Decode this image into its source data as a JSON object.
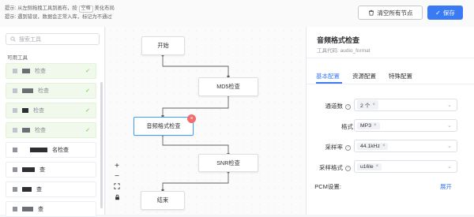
{
  "tips": {
    "line1_pre": "提示: 从左侧拖拽工具到画布，按",
    "line1_key": "空格",
    "line1_post": "美化布局",
    "line2": "提示: 遇到错误，数据会正常入库，标记为不通过"
  },
  "toolbar": {
    "clear_label": "清空所有节点",
    "save_label": "保存"
  },
  "left": {
    "search_placeholder": "搜索工具",
    "available_label": "可用工具",
    "tools": [
      {
        "label": "检查",
        "used": true
      },
      {
        "label": "检查",
        "used": true
      },
      {
        "label": "检查",
        "used": true
      },
      {
        "label": "检查",
        "used": true
      },
      {
        "label": "名检查",
        "used": false
      },
      {
        "label": "查",
        "used": false
      },
      {
        "label": "查",
        "used": false
      },
      {
        "label": "查",
        "used": false
      }
    ]
  },
  "canvas": {
    "nodes": [
      "开始",
      "MD5检查",
      "音频格式检查",
      "SNR检查",
      "结束"
    ],
    "zoom_in": "+",
    "zoom_out": "−"
  },
  "panel": {
    "title": "音频格式检查",
    "code": "工具代码: audio_format",
    "tabs": [
      "基本配置",
      "资源配置",
      "特殊配置"
    ],
    "fields": [
      {
        "label": "通道数",
        "value": "2 个"
      },
      {
        "label": "格式",
        "value": "MP3"
      },
      {
        "label": "采样率",
        "value": "44.1kHz"
      },
      {
        "label": "采样格式",
        "value": "u16le"
      }
    ],
    "pcm_label": "PCM设置:",
    "expand_label": "展开"
  },
  "colors": {
    "accent": "#3a7bf5",
    "selected": "#409eff",
    "danger": "#f56c6c",
    "success": "#67c23a"
  }
}
